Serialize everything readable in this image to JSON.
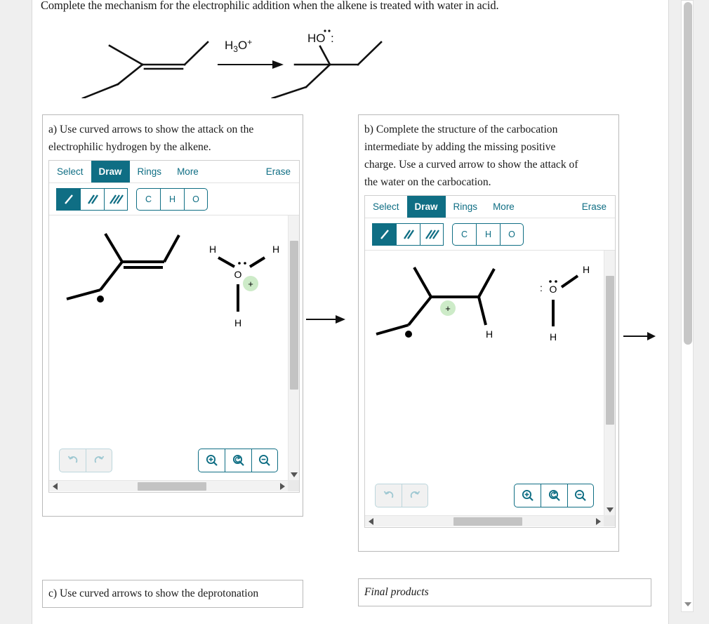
{
  "page": {
    "heading": "Complete the mechanism for the electrophilic addition when the alkene is treated with water in acid."
  },
  "scheme": {
    "reagent_label": "H3O+",
    "reagent_sub": "3",
    "reagent_sup": "+",
    "product_label": "HO:",
    "arrow": "reaction-arrow"
  },
  "panel_a": {
    "prompt_line1": "a) Use curved arrows to show the attack on the",
    "prompt_line2": "electrophilic hydrogen by the alkene.",
    "toolbar": {
      "tabs": [
        {
          "label": "Select",
          "active": false
        },
        {
          "label": "Draw",
          "active": true
        },
        {
          "label": "Rings",
          "active": false
        },
        {
          "label": "More",
          "active": false
        }
      ],
      "erase_label": "Erase",
      "bond_tools": [
        {
          "name": "single-bond",
          "glyph": "/",
          "active": true
        },
        {
          "name": "double-bond",
          "glyph": "//",
          "active": false
        },
        {
          "name": "triple-bond",
          "glyph": "///",
          "active": false
        }
      ],
      "atom_tools": [
        {
          "label": "C"
        },
        {
          "label": "H"
        },
        {
          "label": "O"
        }
      ]
    },
    "canvas": {
      "molecule_left": "alkene-skeleton",
      "molecule_right": "hydronium-ion",
      "hydronium": {
        "oxygen": "O",
        "h_left": "H",
        "h_right": "H",
        "h_bottom": "H",
        "charge": "+",
        "charge_color": "#cdebc8"
      }
    },
    "controls": {
      "undo": "undo-icon",
      "redo": "redo-icon",
      "zoom_in": "zoom-in-icon",
      "zoom_reset": "zoom-reset-icon",
      "zoom_out": "zoom-out-icon"
    }
  },
  "panel_b": {
    "prompt_line1": "b) Complete the structure of the carbocation",
    "prompt_line2": "intermediate by adding the missing positive",
    "prompt_line3": "charge. Use a curved arrow to show the attack of",
    "prompt_line4": "the water on the carbocation.",
    "toolbar": {
      "tabs": [
        {
          "label": "Select",
          "active": false
        },
        {
          "label": "Draw",
          "active": true
        },
        {
          "label": "Rings",
          "active": false
        },
        {
          "label": "More",
          "active": false
        }
      ],
      "erase_label": "Erase",
      "bond_tools": [
        {
          "name": "single-bond",
          "glyph": "/",
          "active": true
        },
        {
          "name": "double-bond",
          "glyph": "//",
          "active": false
        },
        {
          "name": "triple-bond",
          "glyph": "///",
          "active": false
        }
      ],
      "atom_tools": [
        {
          "label": "C"
        },
        {
          "label": "H"
        },
        {
          "label": "O"
        }
      ]
    },
    "canvas": {
      "molecule_left": "carbocation-skeleton",
      "molecule_right": "water-molecule",
      "carbocation": {
        "charge": "+",
        "charge_color": "#cdebc8",
        "h_label": "H"
      },
      "water": {
        "oxygen": "O",
        "h_upper_right": "H",
        "h_bottom": "H",
        "lone_pair_left": ":"
      }
    },
    "controls": {
      "undo": "undo-icon",
      "redo": "redo-icon",
      "zoom_in": "zoom-in-icon",
      "zoom_reset": "zoom-reset-icon",
      "zoom_out": "zoom-out-icon"
    }
  },
  "panel_c": {
    "prompt_line1": "c) Use curved arrows to show the deprotonation"
  },
  "final_products": {
    "label": "Final products"
  },
  "colors": {
    "accent_teal": "#0f6e84",
    "charge_highlight": "#cdebc8",
    "panel_border": "#b9b9b9",
    "scrollbar_thumb": "#c3c3c3"
  }
}
